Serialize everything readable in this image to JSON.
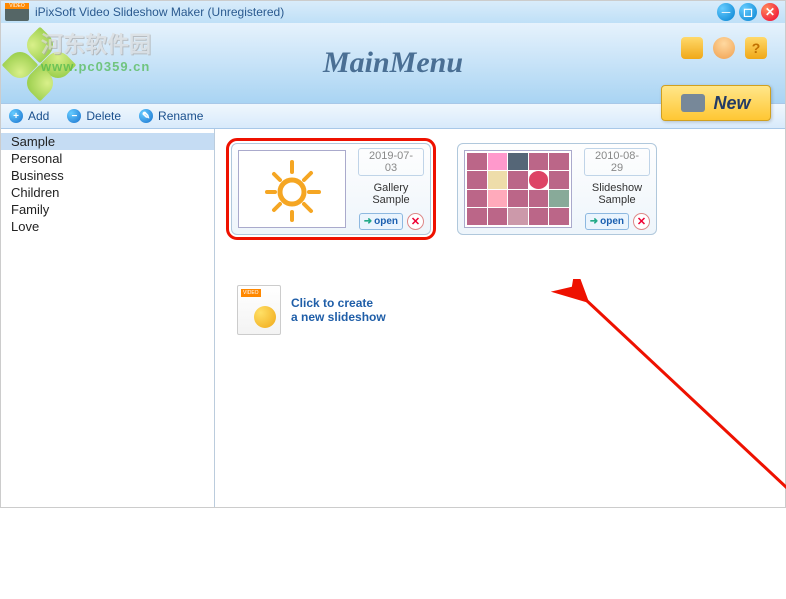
{
  "app": {
    "title": "iPixSoft Video Slideshow Maker (Unregistered)",
    "main_title": "MainMenu",
    "new_button": "New"
  },
  "watermark": {
    "text_cn": "河东软件园",
    "url": "www.pc0359.cn"
  },
  "toolbar": {
    "add": "Add",
    "delete": "Delete",
    "rename": "Rename"
  },
  "sidebar": {
    "items": [
      "Sample",
      "Personal",
      "Business",
      "Children",
      "Family",
      "Love"
    ],
    "selected_index": 0
  },
  "cards": [
    {
      "date": "2019-07-03",
      "name": "Gallery Sample",
      "open_label": "open",
      "highlighted": true,
      "thumb_type": "sun"
    },
    {
      "date": "2010-08-29",
      "name": "Slideshow Sample",
      "open_label": "open",
      "highlighted": false,
      "thumb_type": "grid"
    }
  ],
  "create": {
    "line1": "Click to create",
    "line2": "a new slideshow"
  }
}
